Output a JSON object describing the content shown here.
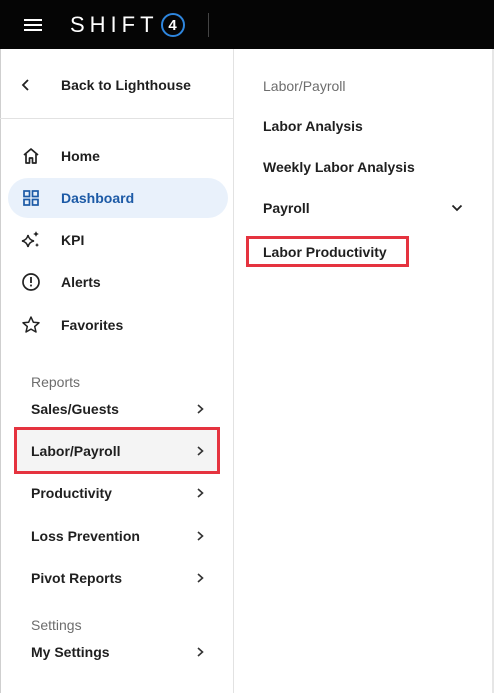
{
  "header": {
    "brand_text": "SHIFT",
    "brand_badge": "4",
    "menu_icon": "hamburger-icon"
  },
  "left_nav": {
    "back": {
      "label": "Back to Lighthouse",
      "icon": "chevron-left-icon"
    },
    "items": [
      {
        "label": "Home",
        "icon": "home-icon"
      },
      {
        "label": "Dashboard",
        "icon": "grid-icon",
        "active": true
      },
      {
        "label": "KPI",
        "icon": "sparkle-icon"
      },
      {
        "label": "Alerts",
        "icon": "alert-circle-icon"
      },
      {
        "label": "Favorites",
        "icon": "star-icon"
      }
    ],
    "reports_header": "Reports",
    "reports": [
      {
        "label": "Sales/Guests"
      },
      {
        "label": "Labor/Payroll",
        "highlighted": true
      },
      {
        "label": "Productivity"
      },
      {
        "label": "Loss Prevention"
      },
      {
        "label": "Pivot Reports"
      }
    ],
    "settings_header": "Settings",
    "settings": [
      {
        "label": "My Settings"
      }
    ]
  },
  "submenu": {
    "header": "Labor/Payroll",
    "items": [
      {
        "label": "Labor Analysis"
      },
      {
        "label": "Weekly Labor Analysis"
      },
      {
        "label": "Payroll",
        "expandable": true
      },
      {
        "label": "Labor Productivity",
        "highlighted": true
      }
    ]
  },
  "colors": {
    "topbar": "#050505",
    "active_bg": "#e9f1fb",
    "active_text": "#1c5aa6",
    "highlight_border": "#e5333f"
  }
}
